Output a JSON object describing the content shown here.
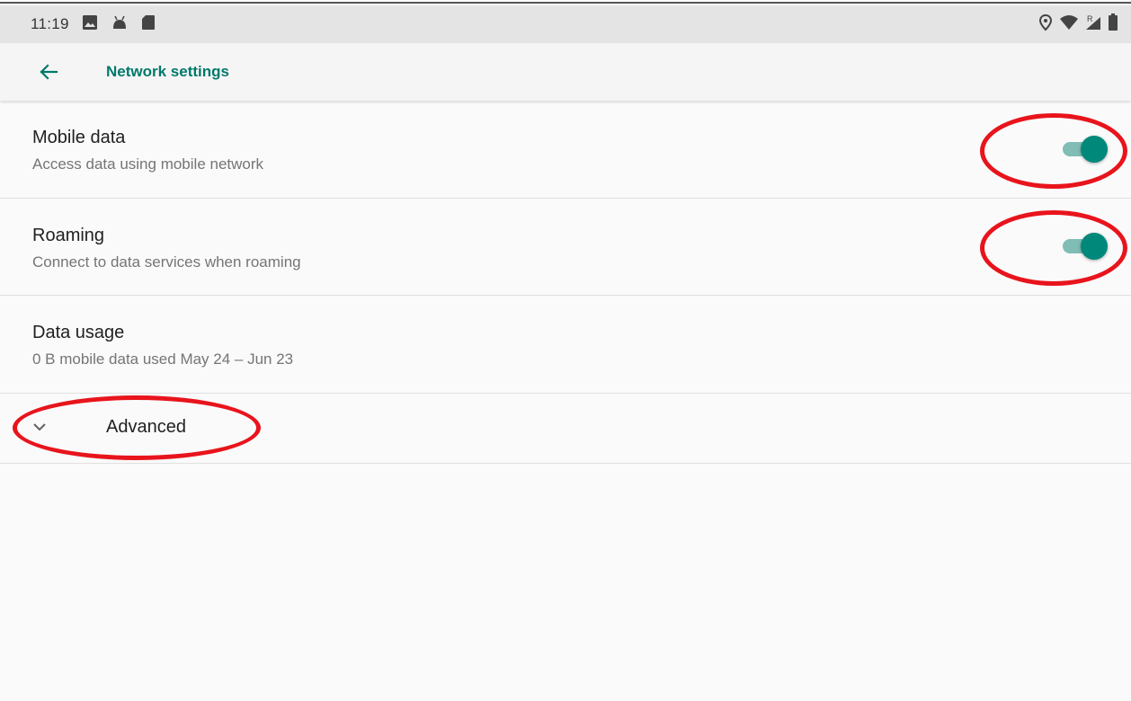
{
  "status_bar": {
    "time": "11:19",
    "left_icons": [
      "image-icon",
      "android-icon",
      "sd-card-icon"
    ],
    "right_icons": [
      "location-icon",
      "wifi-icon",
      "signal-roaming-icon",
      "battery-icon"
    ],
    "roaming_indicator": "R"
  },
  "app_bar": {
    "title": "Network settings"
  },
  "settings": [
    {
      "title": "Mobile data",
      "subtitle": "Access data using mobile network",
      "enabled": true
    },
    {
      "title": "Roaming",
      "subtitle": "Connect to data services when roaming",
      "enabled": true
    },
    {
      "title": "Data usage",
      "subtitle": "0 B mobile data used May 24 – Jun 23"
    }
  ],
  "advanced": {
    "label": "Advanced"
  },
  "colors": {
    "accent": "#00796b",
    "switch_thumb": "#00897b",
    "switch_track": "#7fbdb5",
    "annotation": "#e8141c"
  }
}
